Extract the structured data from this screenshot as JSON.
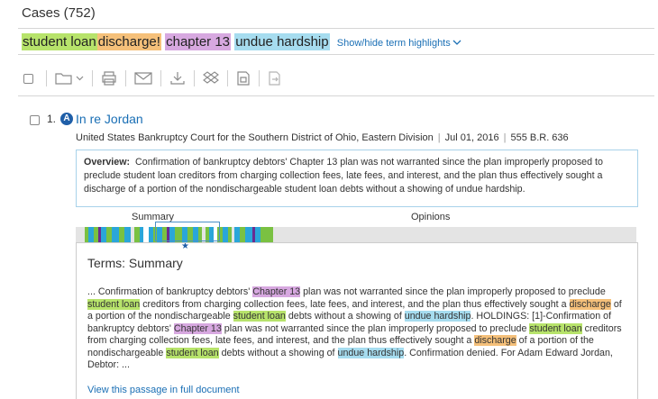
{
  "header": {
    "title": "Cases (752)"
  },
  "terms": {
    "items": [
      {
        "label": "student loan"
      },
      {
        "label": "discharge!"
      },
      {
        "label": "chapter 13"
      },
      {
        "label": "undue hardship"
      }
    ],
    "toggle_label": "Show/hide term highlights"
  },
  "toolbar": {
    "icons": [
      "folder-icon",
      "chevron-down-icon",
      "print-icon",
      "email-icon",
      "download-icon",
      "dropbox-icon",
      "copy-document-icon",
      "export-icon"
    ]
  },
  "result": {
    "number": "1.",
    "badge": "A",
    "title": "In re Jordan",
    "court": "United States Bankruptcy Court for the Southern District of Ohio, Eastern Division",
    "date": "Jul 01, 2016",
    "citation": "555 B.R. 636",
    "overview_label": "Overview:",
    "overview_text": "Confirmation of bankruptcy debtors' Chapter 13 plan was not warranted since the plan improperly proposed to preclude student loan creditors from charging collection fees, late fees, and interest, and the plan thus effectively sought a discharge of a portion of the nondischargeable student loan debts without a showing of undue hardship."
  },
  "tabs": {
    "summary": "Summary",
    "opinions": "Opinions"
  },
  "colors": {
    "green": "#b7e36b",
    "orange": "#f5c07a",
    "purple": "#d7a8e0",
    "blue": "#a6dcef",
    "link": "#1a6fb5"
  },
  "panel": {
    "title": "Terms: Summary",
    "passage": [
      {
        "t": "... Confirmation of bankruptcy debtors' "
      },
      {
        "t": "Chapter 13",
        "c": "purple"
      },
      {
        "t": " plan was not warranted since the plan improperly proposed to preclude "
      },
      {
        "t": "student loan",
        "c": "green"
      },
      {
        "t": " creditors from charging collection fees, late fees, and interest, and the plan thus effectively sought a "
      },
      {
        "t": "discharge",
        "c": "orange"
      },
      {
        "t": " of a portion of the nondischargeable "
      },
      {
        "t": "student loan",
        "c": "green"
      },
      {
        "t": " debts without a showing of "
      },
      {
        "t": "undue hardship",
        "c": "blue"
      },
      {
        "t": ". HOLDINGS: [1]-Confirmation of bankruptcy debtors' "
      },
      {
        "t": "Chapter 13",
        "c": "purple"
      },
      {
        "t": " plan was not warranted since the plan improperly proposed to preclude "
      },
      {
        "t": "student loan",
        "c": "green"
      },
      {
        "t": " creditors from charging collection fees, late fees, and interest, and the plan thus effectively sought a "
      },
      {
        "t": "discharge",
        "c": "orange"
      },
      {
        "t": " of a portion of the nondischargeable "
      },
      {
        "t": "student loan",
        "c": "green"
      },
      {
        "t": " debts without a showing of "
      },
      {
        "t": "undue hardship",
        "c": "blue"
      },
      {
        "t": ". Confirmation denied. For Adam Edward Jordan, Debtor: ..."
      }
    ],
    "view_link": "View this passage in full document"
  }
}
